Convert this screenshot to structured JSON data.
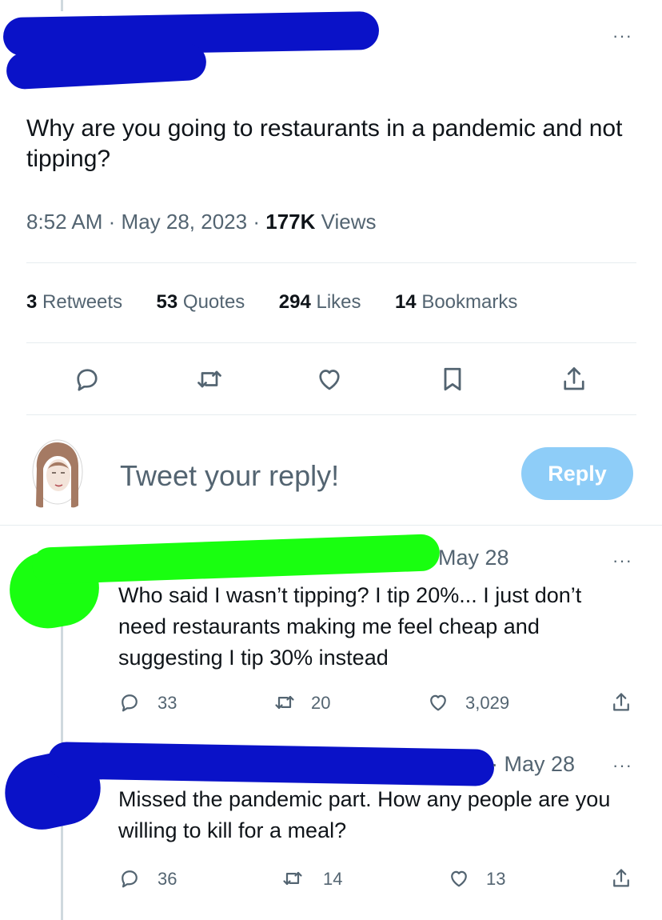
{
  "main_tweet": {
    "text": "Why are you going to restaurants in a pandemic and not tipping?",
    "time": "8:52 AM",
    "sep1": "·",
    "date": "May 28, 2023",
    "sep2": "·",
    "views_count": "177K",
    "views_label": "Views",
    "stats": {
      "retweets_count": "3",
      "retweets_label": "Retweets",
      "quotes_count": "53",
      "quotes_label": "Quotes",
      "likes_count": "294",
      "likes_label": "Likes",
      "bookmarks_count": "14",
      "bookmarks_label": "Bookmarks"
    },
    "more": "···"
  },
  "composer": {
    "placeholder": "Tweet your reply!",
    "button_label": "Reply"
  },
  "replies": [
    {
      "date": "May 28",
      "text": "Who said I wasn’t tipping? I tip 20%... I just don’t need restaurants making me feel cheap and suggesting I tip 30% instead",
      "replies": "33",
      "retweets": "20",
      "likes": "3,029",
      "more": "···"
    },
    {
      "sep": "·",
      "date": "May 28",
      "text": "Missed the pandemic part.  How any people are you willing to kill for a meal?",
      "replies": "36",
      "retweets": "14",
      "likes": "13",
      "more": "···"
    }
  ],
  "colors": {
    "accent": "#1d9bf0",
    "reply_button": "#8ecdf8",
    "redaction_blue": "#0a12c8",
    "redaction_green": "#19ff10"
  },
  "icons": [
    "reply-icon",
    "retweet-icon",
    "like-icon",
    "bookmark-icon",
    "share-icon",
    "more-icon"
  ]
}
